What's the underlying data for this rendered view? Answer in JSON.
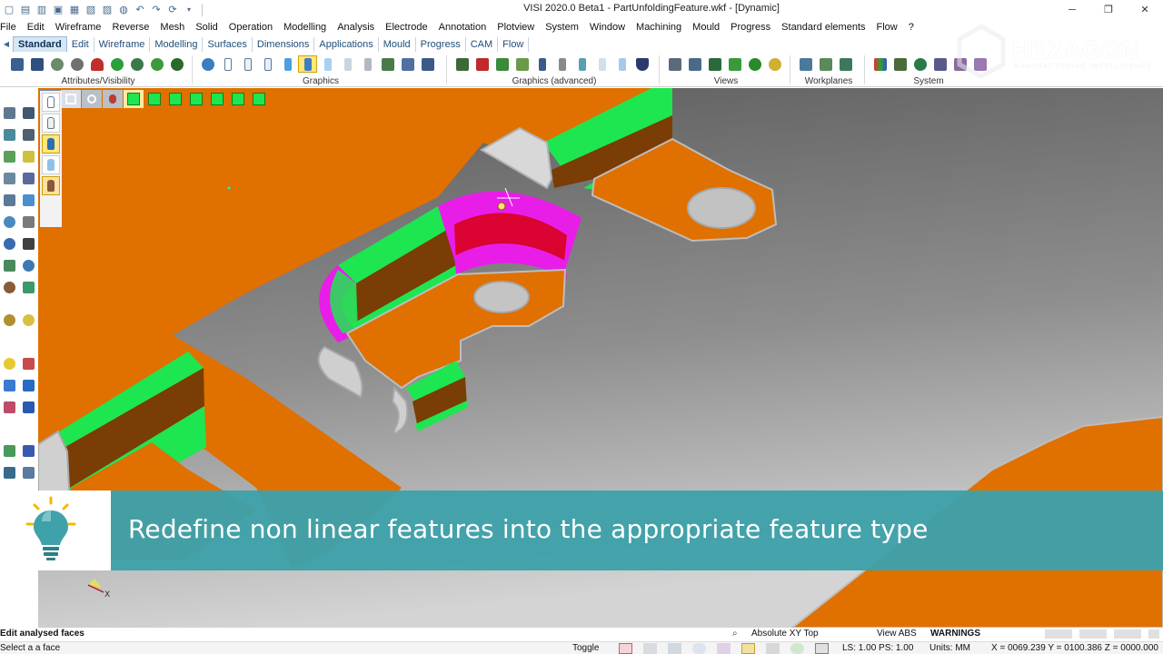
{
  "window": {
    "title": "VISI 2020.0 Beta1 - PartUnfoldingFeature.wkf - [Dynamic]",
    "controls": [
      "─",
      "❐",
      "✕"
    ]
  },
  "menus": [
    "File",
    "Edit",
    "Wireframe",
    "Reverse",
    "Mesh",
    "Solid",
    "Operation",
    "Modelling",
    "Analysis",
    "Electrode",
    "Annotation",
    "Plotview",
    "System",
    "Window",
    "Machining",
    "Mould",
    "Progress",
    "Standard elements",
    "Flow",
    "?"
  ],
  "ribbon_tabs": {
    "active": "Standard",
    "others": [
      "Edit",
      "Wireframe",
      "Modelling",
      "Surfaces",
      "Dimensions",
      "Applications",
      "Mould",
      "Progress",
      "CAM",
      "Flow"
    ]
  },
  "ribbon_groups": {
    "attributes": "Attributes/Visibility",
    "graphics": "Graphics",
    "graphics_adv": "Graphics (advanced)",
    "views": "Views",
    "workplanes": "Workplanes",
    "system": "System"
  },
  "brand": {
    "name": "HEXAGON",
    "sub": "MANUFACTURING INTELLIGENCE"
  },
  "tip": {
    "text": "Redefine non linear features into the appropriate feature type"
  },
  "status": {
    "command": "Edit analysed faces",
    "prompt": "Select a a face",
    "view_mode": "Absolute XY Top",
    "view_abs": "View ABS",
    "warnings": "WARNINGS",
    "toggle": "Toggle",
    "ls_ps": "LS: 1.00 PS: 1.00",
    "units": "Units: MM",
    "coords": "X = 0069.239 Y = 0100.386 Z = 0000.000"
  },
  "colors": {
    "part_face": "#e07000",
    "bend_green": "#1ee650",
    "bend_dark": "#7a3d05",
    "selected_face": "#e81ee8",
    "selected_inner": "#d8001e",
    "edge_grey": "#b9b9b9",
    "tip_band": "#3fa1a9"
  },
  "axis": {
    "x_label": "X"
  }
}
